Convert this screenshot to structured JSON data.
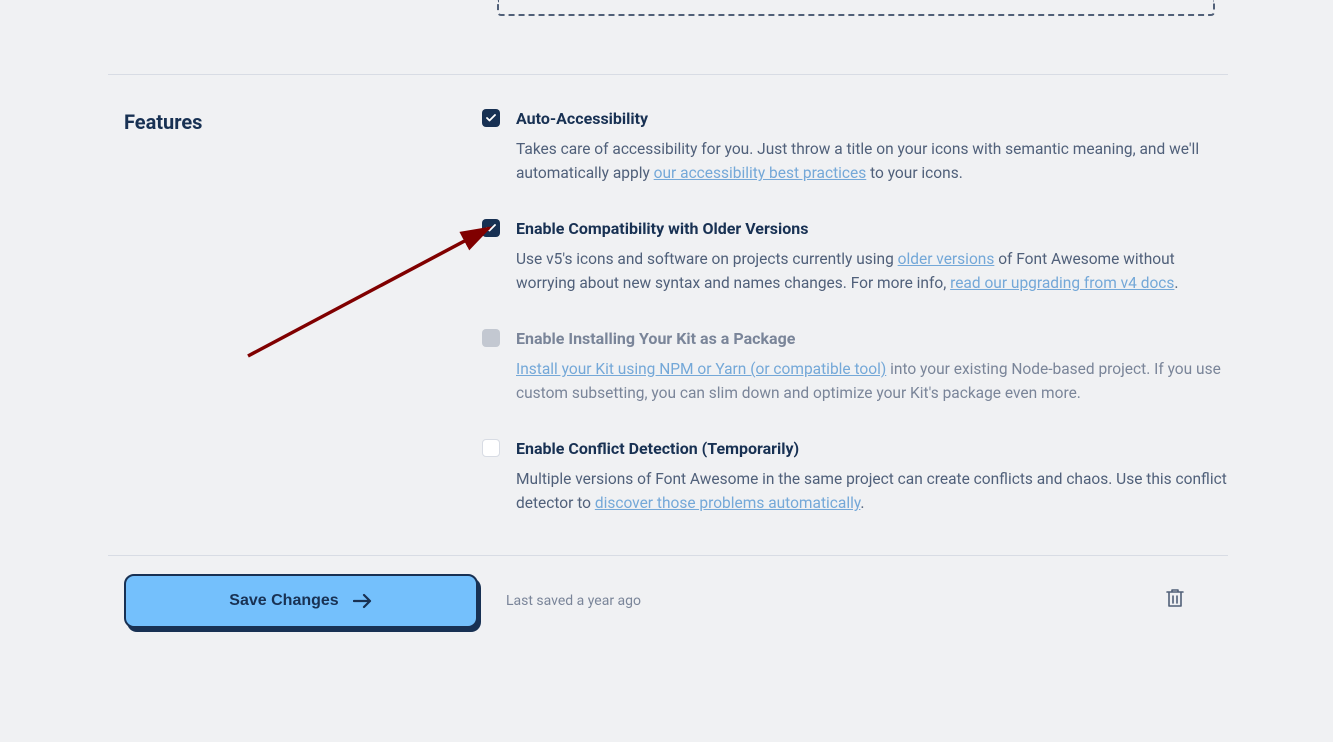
{
  "section_title": "Features",
  "features": [
    {
      "title": "Auto-Accessibility",
      "desc_pre": "Takes care of accessibility for you. Just throw a title on your icons with semantic meaning, and we'll automatically apply ",
      "link": "our accessibility best practices",
      "desc_post": " to your icons.",
      "state": "checked"
    },
    {
      "title": "Enable Compatibility with Older Versions",
      "desc_pre": "Use v5's icons and software on projects currently using ",
      "link1": "older versions",
      "desc_mid": " of Font Awesome without worrying about new syntax and names changes. For more info, ",
      "link2": "read our upgrading from v4 docs",
      "desc_post": ".",
      "state": "checked"
    },
    {
      "title": "Enable Installing Your Kit as a Package",
      "link": "Install your Kit using NPM or Yarn (or compatible tool)",
      "desc_post": " into your existing Node-based project. If you use custom subsetting, you can slim down and optimize your Kit's package even more.",
      "state": "disabled"
    },
    {
      "title": "Enable Conflict Detection (Temporarily)",
      "desc_pre": "Multiple versions of Font Awesome in the same project can create conflicts and chaos. Use this conflict detector to ",
      "link": "discover those problems automatically",
      "desc_post": ".",
      "state": "unchecked"
    }
  ],
  "footer": {
    "save_label": "Save Changes",
    "last_saved": "Last saved a year ago"
  }
}
